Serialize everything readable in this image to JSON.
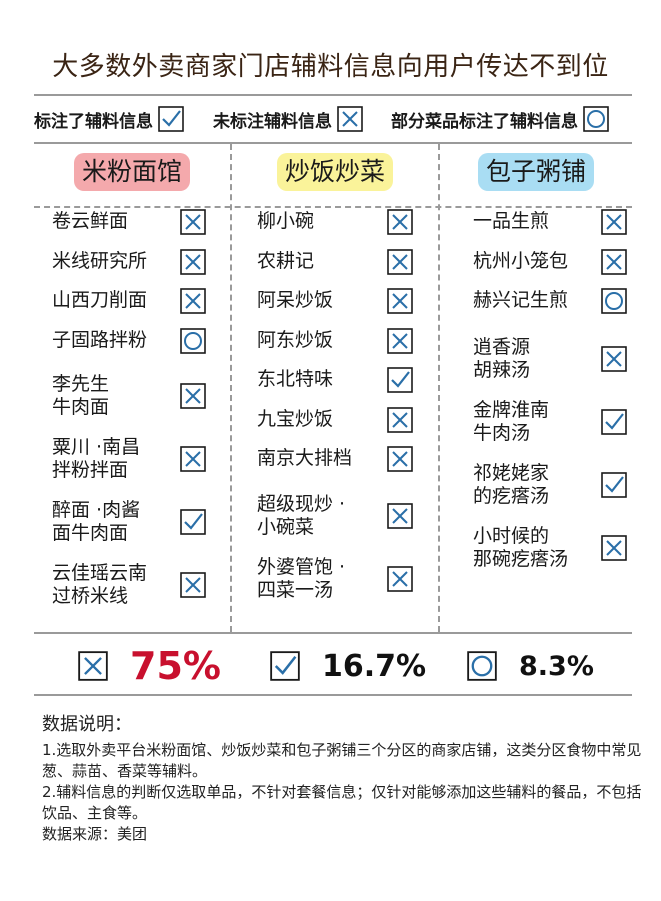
{
  "title": "大多数外卖商家门店辅料信息向用户传达不到位",
  "legend": [
    {
      "label": "标注了辅料信息",
      "icon": "check-box-icon"
    },
    {
      "label": "未标注辅料信息",
      "icon": "cross-box-icon"
    },
    {
      "label": "部分菜品标注了辅料信息",
      "icon": "circle-box-icon"
    }
  ],
  "columns": [
    {
      "header": "米粉面馆",
      "color": "#f4a9ac",
      "items": [
        {
          "lines": [
            "卷云鲜面"
          ],
          "status": "cross"
        },
        {
          "lines": [
            "米线研究所"
          ],
          "status": "cross"
        },
        {
          "lines": [
            "山西刀削面"
          ],
          "status": "cross"
        },
        {
          "lines": [
            "子固路拌粉"
          ],
          "status": "circle"
        },
        {
          "lines": [
            "李先生",
            "牛肉面"
          ],
          "status": "cross"
        },
        {
          "lines": [
            "粟川 ·南昌",
            "拌粉拌面"
          ],
          "status": "cross"
        },
        {
          "lines": [
            "醉面 ·肉酱",
            "面牛肉面"
          ],
          "status": "check"
        },
        {
          "lines": [
            "云佳瑶云南",
            "过桥米线"
          ],
          "status": "cross"
        }
      ]
    },
    {
      "header": "炒饭炒菜",
      "color": "#faf39a",
      "items": [
        {
          "lines": [
            "柳小碗"
          ],
          "status": "cross"
        },
        {
          "lines": [
            "农耕记"
          ],
          "status": "cross"
        },
        {
          "lines": [
            "阿呆炒饭"
          ],
          "status": "cross"
        },
        {
          "lines": [
            "阿东炒饭"
          ],
          "status": "cross"
        },
        {
          "lines": [
            "东北特味"
          ],
          "status": "check"
        },
        {
          "lines": [
            "九宝炒饭"
          ],
          "status": "cross"
        },
        {
          "lines": [
            "南京大排档"
          ],
          "status": "cross"
        },
        {
          "lines": [
            "超级现炒 ·",
            "小碗菜"
          ],
          "status": "cross"
        },
        {
          "lines": [
            "外婆管饱 ·",
            "四菜一汤"
          ],
          "status": "cross"
        }
      ]
    },
    {
      "header": "包子粥铺",
      "color": "#a9ddf3",
      "items": [
        {
          "lines": [
            "一品生煎"
          ],
          "status": "cross"
        },
        {
          "lines": [
            "杭州小笼包"
          ],
          "status": "cross"
        },
        {
          "lines": [
            "赫兴记生煎"
          ],
          "status": "circle"
        },
        {
          "lines": [
            "逍香源",
            "胡辣汤"
          ],
          "status": "cross"
        },
        {
          "lines": [
            "金牌淮南",
            "牛肉汤"
          ],
          "status": "check"
        },
        {
          "lines": [
            "祁姥姥家",
            "的疙瘩汤"
          ],
          "status": "check"
        },
        {
          "lines": [
            "小时候的",
            "那碗疙瘩汤"
          ],
          "status": "cross"
        }
      ]
    }
  ],
  "summary": [
    {
      "icon": "cross-box-icon",
      "value": "75%",
      "accent": "#c8102e"
    },
    {
      "icon": "check-box-icon",
      "value": "16.7%"
    },
    {
      "icon": "circle-box-icon",
      "value": "8.3%"
    }
  ],
  "notes": {
    "heading": "数据说明：",
    "lines": [
      "1.选取外卖平台米粉面馆、炒饭炒菜和包子粥铺三个分区的商家店铺，这类分区食物中常见葱、蒜苗、香菜等辅料。",
      "2.辅料信息的判断仅选取单品，不针对套餐信息；仅针对能够添加这些辅料的餐品，不包括饮品、主食等。",
      "数据来源：美团"
    ]
  },
  "colors": {
    "icon_stroke": "#2a6fa8",
    "rule": "#9a9a9a",
    "title": "#3a2414"
  }
}
